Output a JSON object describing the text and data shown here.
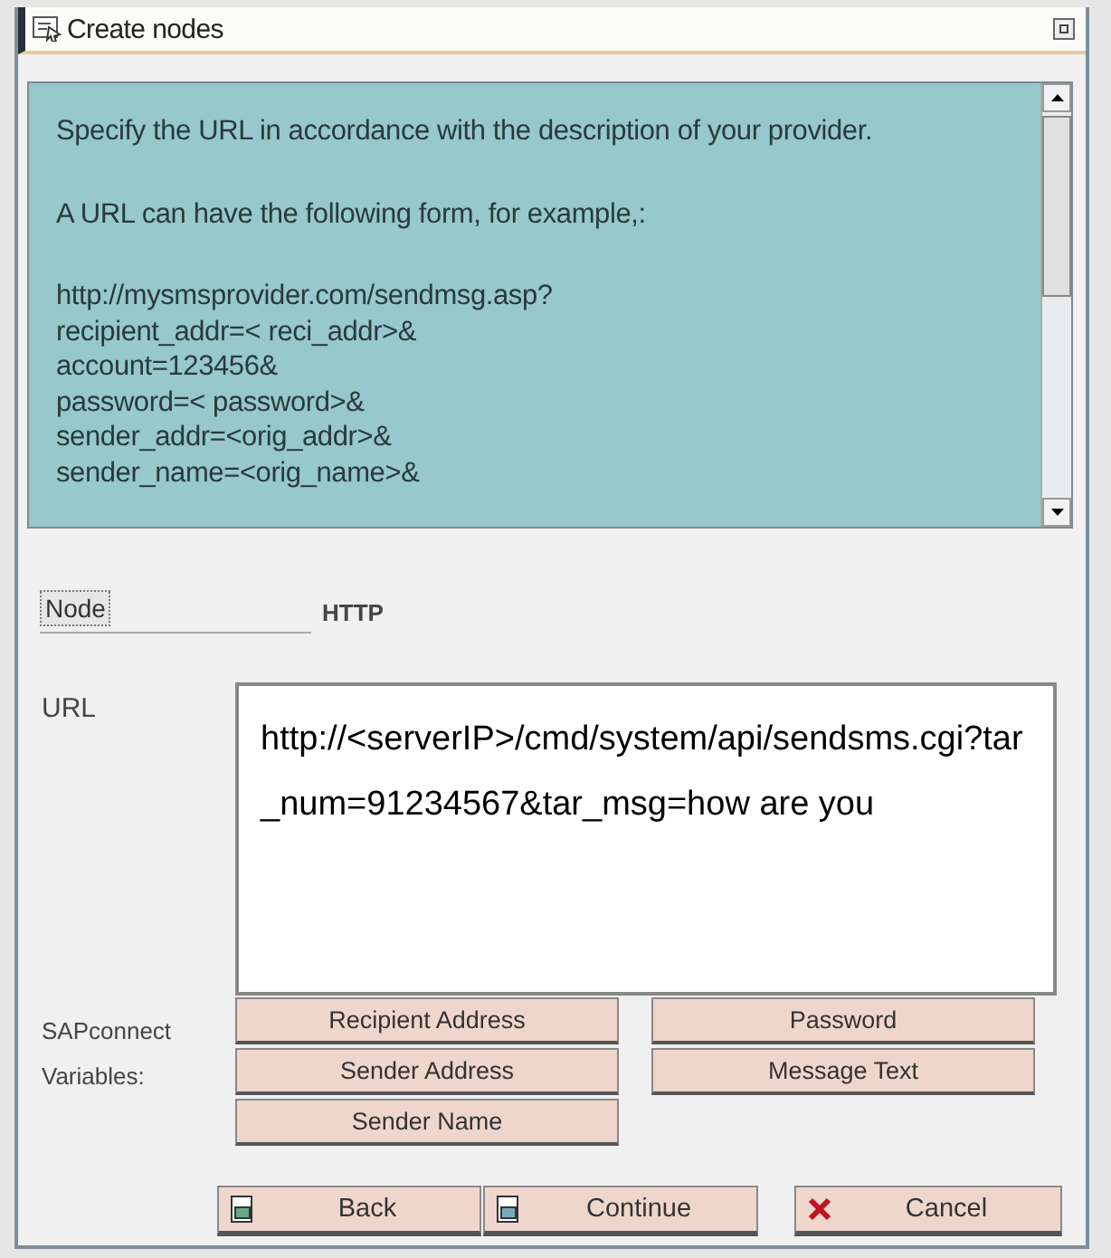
{
  "window": {
    "title": "Create nodes"
  },
  "info": {
    "paragraphs": [
      [
        "Specify the URL in accordance with the description of your provider."
      ],
      [
        "A URL can have the following form, for example,:"
      ],
      [
        "http://mysmsprovider.com/sendmsg.asp?",
        "recipient_addr=< reci_addr>&",
        "account=123456&",
        "password=< password>&",
        "sender_addr=<orig_addr>&",
        "sender_name=<orig_name>&"
      ]
    ]
  },
  "node": {
    "label": "Node",
    "value": "HTTP"
  },
  "url": {
    "label": "URL",
    "value": "http://<serverIP>/cmd/system/api/sendsms.cgi?tar_num=91234567&tar_msg=how are you"
  },
  "variables": {
    "label_lines": [
      "SAPconnect",
      "Variables:"
    ],
    "buttons": [
      "Recipient Address",
      "Password",
      "Sender Address",
      "Message Text",
      "Sender Name"
    ]
  },
  "actions": [
    {
      "label": "Back",
      "kind": "back"
    },
    {
      "label": "Continue",
      "kind": "continue"
    },
    {
      "label": "Cancel",
      "kind": "cancel"
    }
  ]
}
